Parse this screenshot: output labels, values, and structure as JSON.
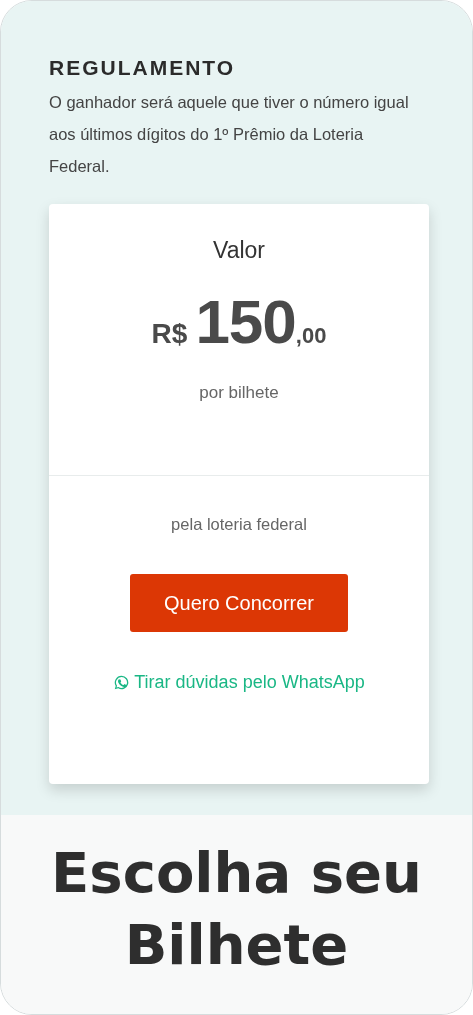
{
  "rules": {
    "title": "REGULAMENTO",
    "text": "O ganhador será aquele que tiver o número igual aos últimos dígitos do 1º Prêmio da Loteria Federal."
  },
  "price_card": {
    "label": "Valor",
    "currency": "R$",
    "amount": "150",
    "cents": ",00",
    "unit": "por bilhete",
    "note": "pela loteria federal",
    "button": "Quero Concorrer",
    "whatsapp_link": "Tirar dúvidas pelo WhatsApp"
  },
  "footer_title": "Escolha seu Bilhete"
}
